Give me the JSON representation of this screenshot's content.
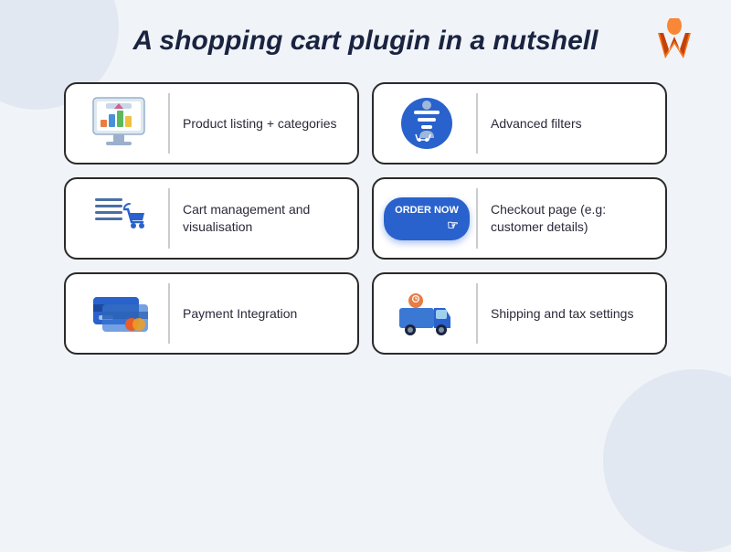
{
  "page": {
    "title": "A shopping cart plugin in a nutshell",
    "background": "#f0f4f8"
  },
  "logo": {
    "alt": "W logo"
  },
  "cards": [
    {
      "id": "product-listing",
      "label": "Product listing + categories",
      "icon": "product-listing-icon"
    },
    {
      "id": "advanced-filters",
      "label": "Advanced filters",
      "icon": "advanced-filters-icon"
    },
    {
      "id": "cart-management",
      "label": "Cart management and visualisation",
      "icon": "cart-management-icon"
    },
    {
      "id": "checkout-page",
      "label": "Checkout page (e.g: customer details)",
      "icon": "order-now-icon"
    },
    {
      "id": "payment-integration",
      "label": "Payment Integration",
      "icon": "payment-integration-icon"
    },
    {
      "id": "shipping-tax",
      "label": "Shipping and tax settings",
      "icon": "shipping-icon"
    }
  ]
}
